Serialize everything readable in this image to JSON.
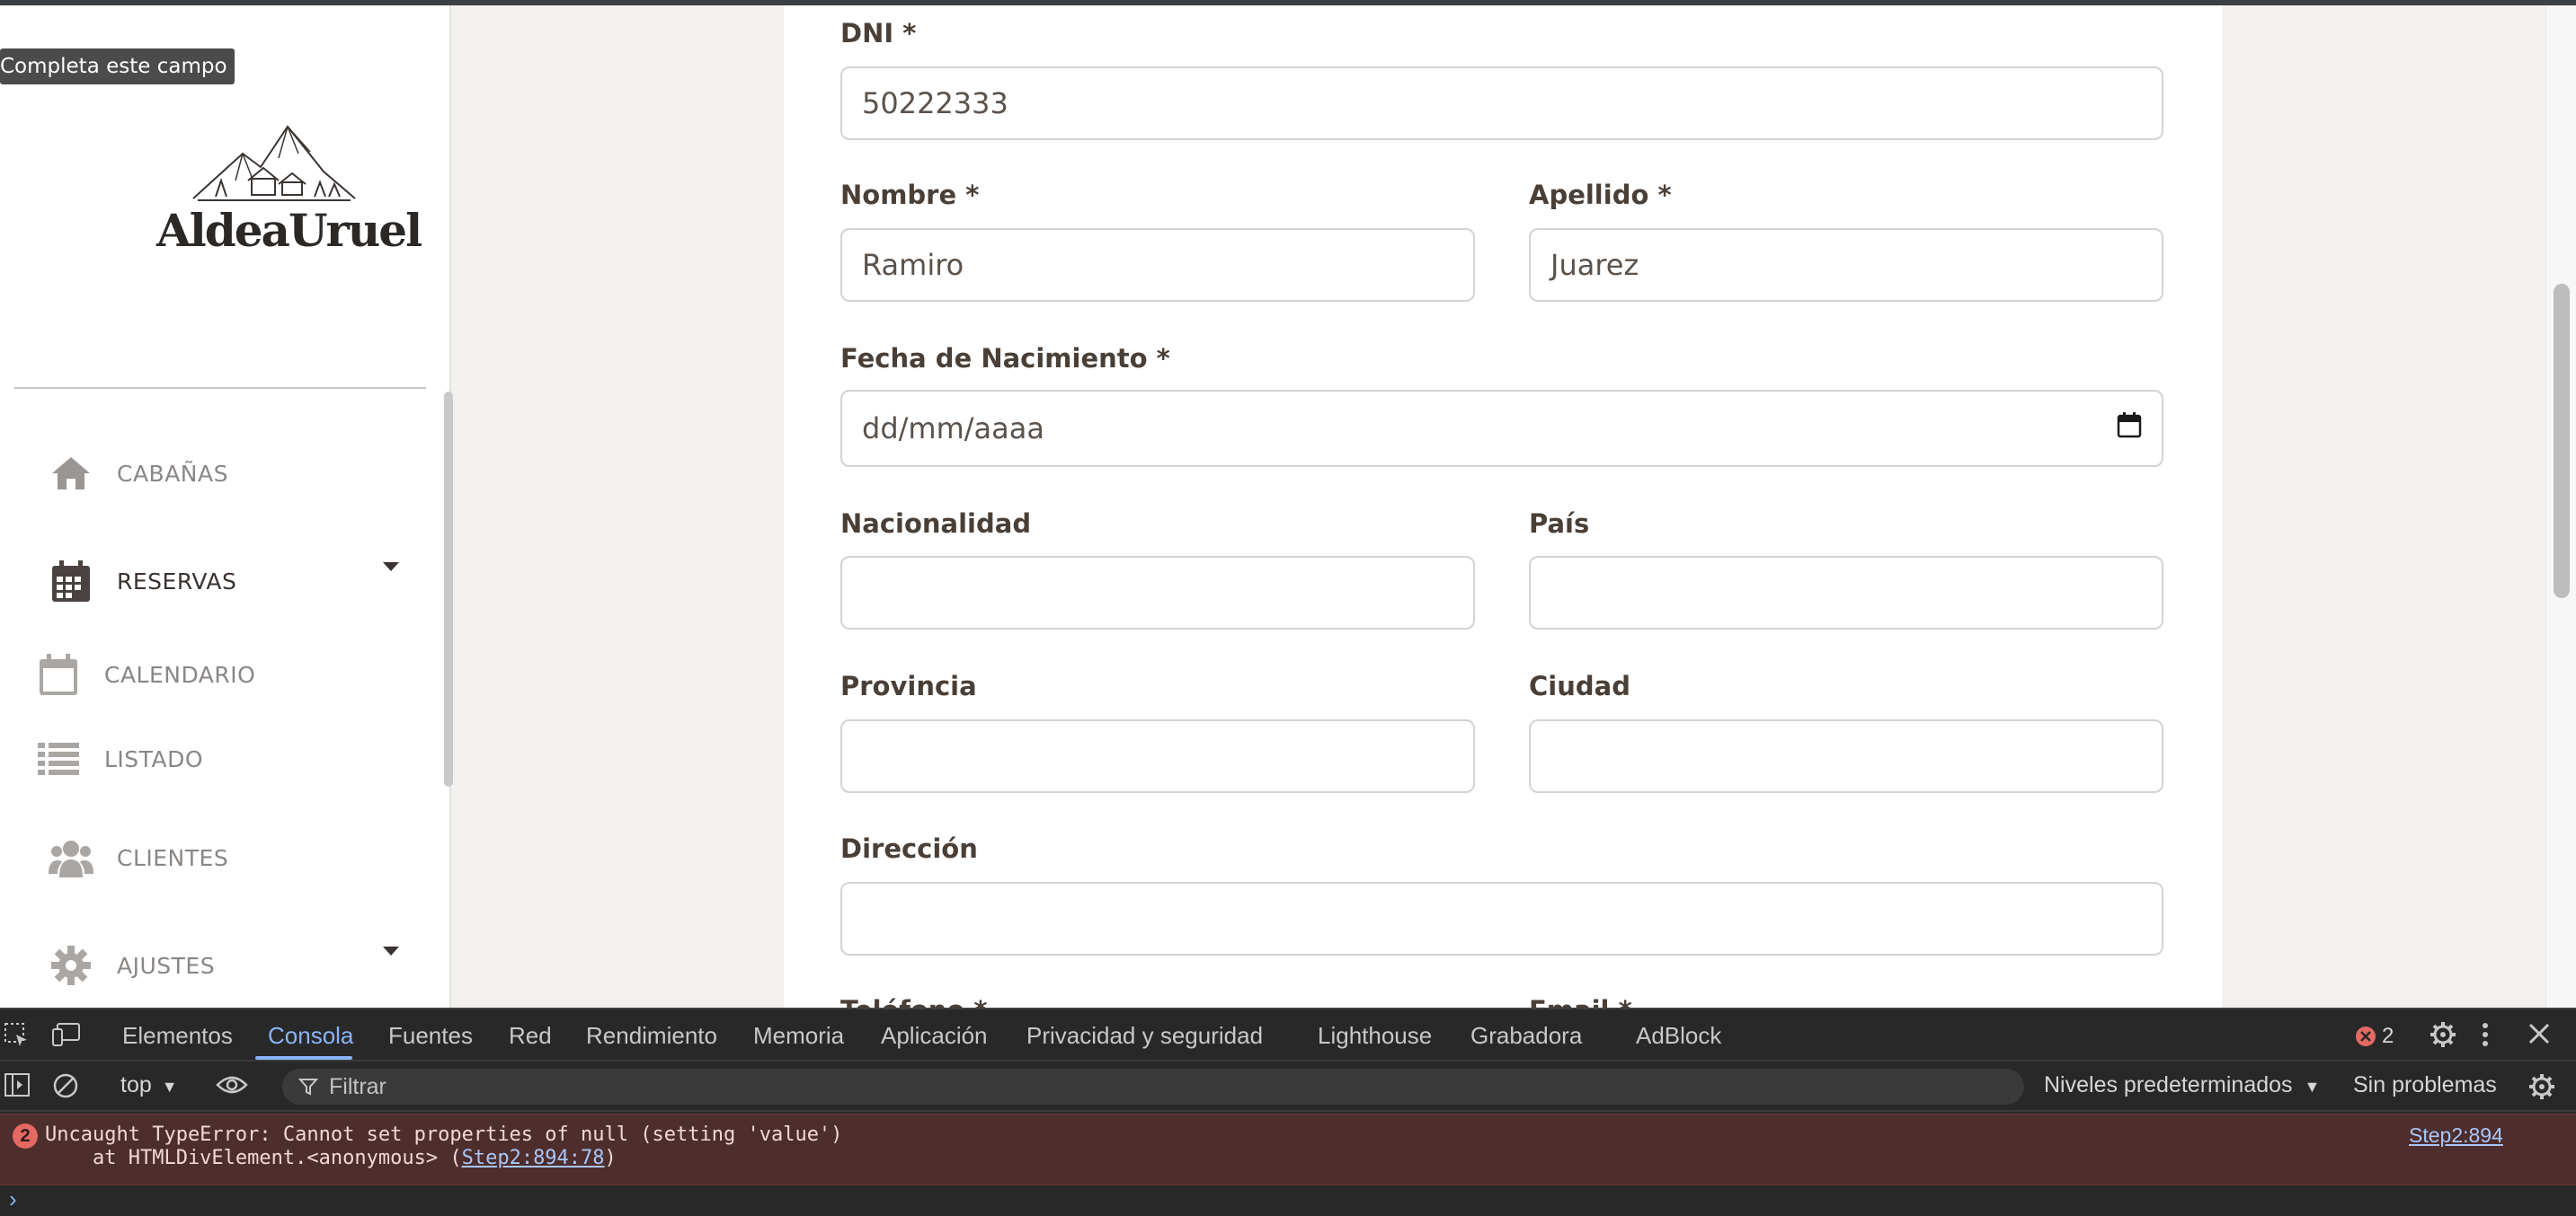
{
  "tooltip": "Completa este campo",
  "logo": {
    "text": "AldeaUruel"
  },
  "sidebar": {
    "items": [
      {
        "label": "CABAÑAS",
        "icon": "home-icon"
      },
      {
        "label": "RESERVAS",
        "icon": "calendar-grid-icon"
      },
      {
        "label": "CALENDARIO",
        "icon": "calendar-icon"
      },
      {
        "label": "LISTADO",
        "icon": "list-icon"
      },
      {
        "label": "CLIENTES",
        "icon": "users-icon"
      },
      {
        "label": "AJUSTES",
        "icon": "gear-icon"
      }
    ]
  },
  "form": {
    "dni_label": "DNI *",
    "dni_value": "50222333",
    "nombre_label": "Nombre *",
    "nombre_value": "Ramiro",
    "apellido_label": "Apellido *",
    "apellido_value": "Juarez",
    "fecha_label": "Fecha de Nacimiento *",
    "fecha_placeholder": "dd/mm/aaaa",
    "nacionalidad_label": "Nacionalidad",
    "pais_label": "País",
    "provincia_label": "Provincia",
    "ciudad_label": "Ciudad",
    "direccion_label": "Dirección",
    "telefono_label": "Teléfono *",
    "email_label": "Email *"
  },
  "devtools": {
    "tabs": [
      "Elementos",
      "Consola",
      "Fuentes",
      "Red",
      "Rendimiento",
      "Memoria",
      "Aplicación",
      "Privacidad y seguridad",
      "Lighthouse",
      "Grabadora",
      "AdBlock"
    ],
    "active_tab": "Consola",
    "error_count": "2",
    "context": "top",
    "filter_placeholder": "Filtrar",
    "levels": "Niveles predeterminados",
    "issues": "Sin problemas",
    "error": {
      "count": "2",
      "message": "Uncaught TypeError: Cannot set properties of null (setting 'value')",
      "stack_prefix": "    at HTMLDivElement.<anonymous> (",
      "stack_link": "Step2:894:78",
      "stack_suffix": ")",
      "source": "Step2:894"
    },
    "prompt": "›"
  },
  "colors": {
    "accent": "#8ab4f8",
    "error_bg": "#4e2d2d",
    "error_badge": "#e46962"
  }
}
